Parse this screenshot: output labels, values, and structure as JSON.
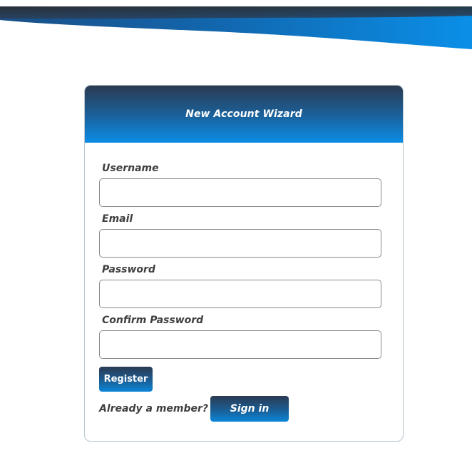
{
  "colors": {
    "header_dark": "#2b3a52",
    "header_light": "#0b8de6",
    "label_text": "#3f3f3f",
    "button_text": "#ffffff"
  },
  "wizard": {
    "title": "New Account Wizard"
  },
  "form": {
    "fields": [
      {
        "label": "Username",
        "value": "",
        "placeholder": ""
      },
      {
        "label": "Email",
        "value": "",
        "placeholder": ""
      },
      {
        "label": "Password",
        "value": "",
        "placeholder": ""
      },
      {
        "label": "Confirm Password",
        "value": "",
        "placeholder": ""
      }
    ],
    "register_label": "Register",
    "member_prompt": "Already a member?",
    "signin_label": "Sign in"
  }
}
